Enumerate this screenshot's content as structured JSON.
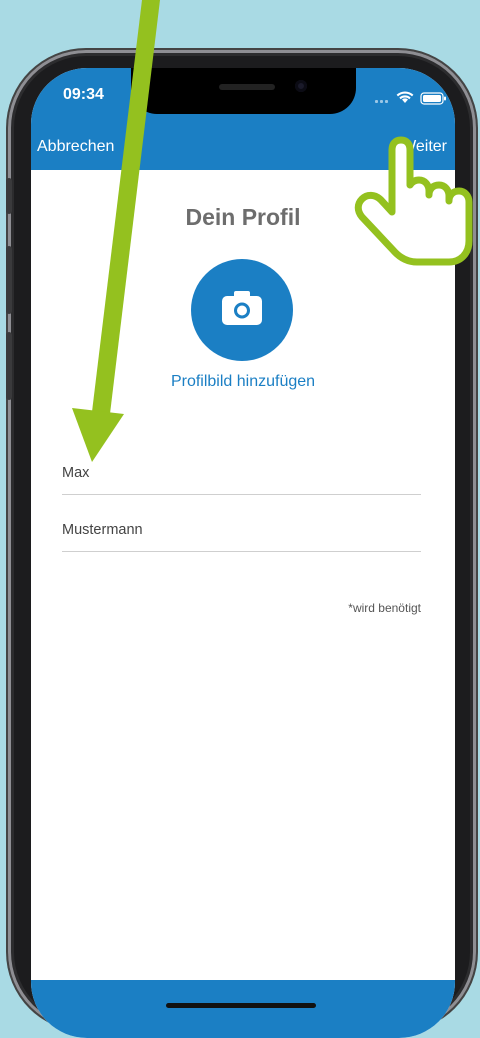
{
  "status": {
    "time": "09:34"
  },
  "nav": {
    "cancel_label": "Abbrechen",
    "next_label": "Weiter"
  },
  "profile": {
    "title": "Dein Profil",
    "add_photo_label": "Profilbild hinzufügen",
    "first_name_value": "Max",
    "last_name_value": "Mustermann",
    "required_note": "*wird benötigt"
  },
  "icons": {
    "camera": "camera-icon",
    "signal": "signal-icon",
    "wifi": "wifi-icon",
    "battery": "battery-icon",
    "arrow": "arrow-annotation",
    "pointer": "pointing-hand-icon"
  },
  "colors": {
    "brand_blue": "#1b7fc4",
    "background": "#a9dae4",
    "arrow_green": "#94c11f"
  }
}
